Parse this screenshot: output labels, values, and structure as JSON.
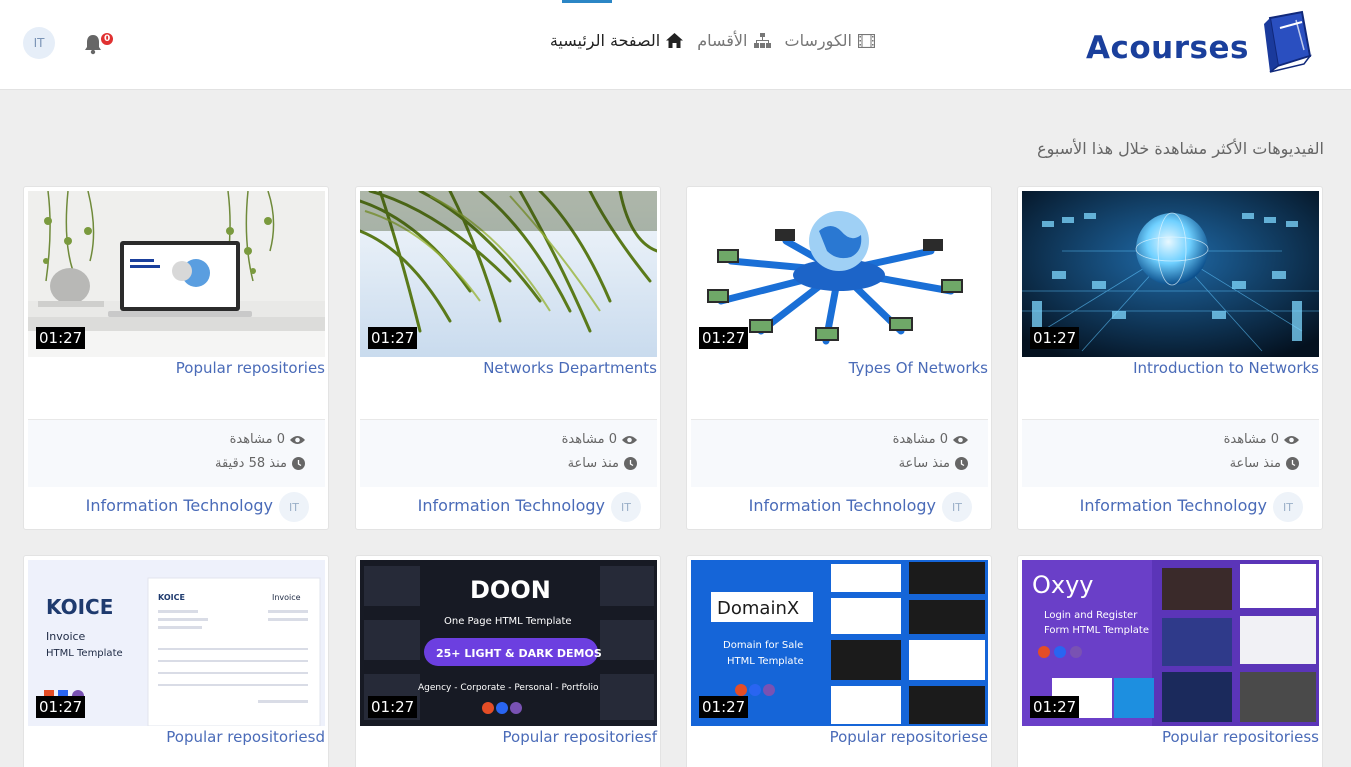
{
  "header": {
    "logo_text": "Acourses",
    "nav": [
      {
        "label": "الصفحة الرئيسية",
        "icon": "home-icon",
        "active": true
      },
      {
        "label": "الأقسام",
        "icon": "sitemap-icon",
        "active": false
      },
      {
        "label": "الكورسات",
        "icon": "film-icon",
        "active": false
      }
    ],
    "notifications_count": "0",
    "user_initials": "IT"
  },
  "section_title": "الفيديوهات الأكثر مشاهدة خلال هذا الأسبوع",
  "videos": [
    {
      "title": "Introduction to Networks",
      "duration": "01:27",
      "views": "0 مشاهدة",
      "time": "منذ ساعة",
      "author": "Information Technology",
      "author_initials": "IT",
      "thumb": "globe-datacenter"
    },
    {
      "title": "Types Of Networks",
      "duration": "01:27",
      "views": "0 مشاهدة",
      "time": "منذ ساعة",
      "author": "Information Technology",
      "author_initials": "IT",
      "thumb": "network-hub"
    },
    {
      "title": "Networks Departments",
      "duration": "01:27",
      "views": "0 مشاهدة",
      "time": "منذ ساعة",
      "author": "Information Technology",
      "author_initials": "IT",
      "thumb": "palm-leaves"
    },
    {
      "title": "Popular repositories",
      "duration": "01:27",
      "views": "0 مشاهدة",
      "time": "منذ 58 دقيقة",
      "author": "Information Technology",
      "author_initials": "IT",
      "thumb": "laptop-desk"
    },
    {
      "title": "Popular repositoriess",
      "duration": "01:27",
      "thumb": "oxyy-template",
      "thumb_text": {
        "brand": "Oxyy",
        "line1": "Login and Register",
        "line2": "Form HTML Template"
      }
    },
    {
      "title": "Popular repositoriese",
      "duration": "01:27",
      "thumb": "domainx-template",
      "thumb_text": {
        "brand": "DomainX",
        "line1": "Domain for Sale",
        "line2": "HTML Template"
      }
    },
    {
      "title": "Popular repositoriesf",
      "duration": "01:27",
      "thumb": "doon-template",
      "thumb_text": {
        "brand": "DOON",
        "line1": "One Page HTML Template",
        "line2": "25+ LIGHT & DARK DEMOS",
        "line3": "Agency - Corporate - Personal - Portfolio"
      }
    },
    {
      "title": "Popular repositoriesd",
      "duration": "01:27",
      "thumb": "koice-template",
      "thumb_text": {
        "brand": "KOICE",
        "line1": "Invoice",
        "line2": "HTML Template",
        "doc": "Invoice"
      }
    }
  ],
  "colors": {
    "accent": "#4a6bb8",
    "logo": "#1a3f9c",
    "badge": "#e03131"
  }
}
